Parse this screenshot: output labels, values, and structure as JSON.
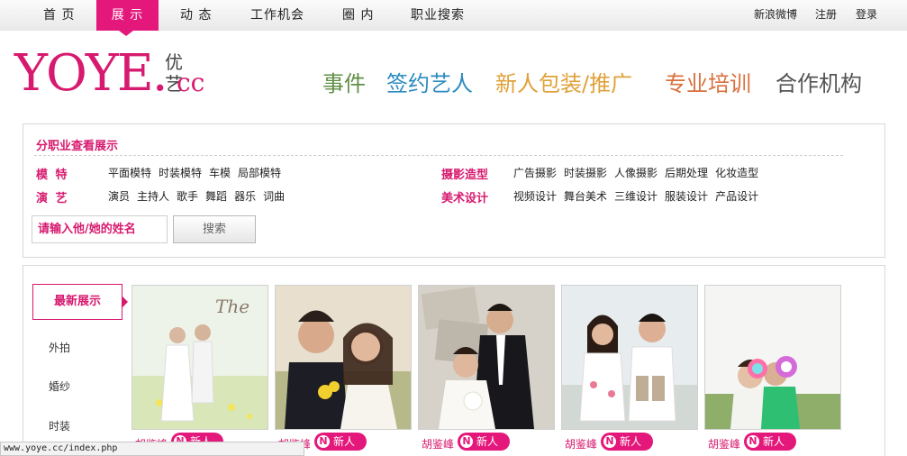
{
  "nav": {
    "items": [
      {
        "label": "首 页"
      },
      {
        "label": "展 示"
      },
      {
        "label": "动 态"
      },
      {
        "label": "工作机会"
      },
      {
        "label": "圈 内"
      },
      {
        "label": "职业搜索"
      }
    ],
    "active_index": 1,
    "right_links": [
      {
        "label": "新浪微博"
      },
      {
        "label": "注册"
      },
      {
        "label": "登录"
      }
    ],
    "active_color": "#e4187b"
  },
  "logo": {
    "main": "YOYE.",
    "cn": "优艺",
    "cc": "cc",
    "color": "#d71a6f"
  },
  "categories": [
    {
      "label": "事件",
      "color": "#5f8f45"
    },
    {
      "label": "签约艺人",
      "color": "#2b8bbf"
    },
    {
      "label": "新人包装/推广",
      "color": "#e0a13a"
    },
    {
      "label": "专业培训",
      "color": "#d96f3c"
    },
    {
      "label": "合作机构",
      "color": "#555555"
    }
  ],
  "filter": {
    "title": "分职业查看展示",
    "groups": [
      {
        "label": "模 特",
        "items": [
          "平面模特",
          "时装模特",
          "车模",
          "局部模特"
        ]
      },
      {
        "label": "演 艺",
        "items": [
          "演员",
          "主持人",
          "歌手",
          "舞蹈",
          "器乐",
          "词曲"
        ]
      },
      {
        "label": "摄影造型",
        "items": [
          "广告摄影",
          "时装摄影",
          "人像摄影",
          "后期处理",
          "化妆造型"
        ]
      },
      {
        "label": "美术设计",
        "items": [
          "视频设计",
          "舞台美术",
          "三维设计",
          "服装设计",
          "产品设计"
        ]
      }
    ],
    "name_placeholder": "请输入他/她的姓名",
    "search_label": "搜索"
  },
  "gallery": {
    "side_active": "最新展示",
    "side_items": [
      "外拍",
      "婚纱",
      "时装"
    ],
    "cards": [
      {
        "name": "胡鉴峰",
        "badge": "新人"
      },
      {
        "name": "胡鉴峰",
        "badge": "新人"
      },
      {
        "name": "胡鉴峰",
        "badge": "新人"
      },
      {
        "name": "胡鉴峰",
        "badge": "新人"
      },
      {
        "name": "胡鉴峰",
        "badge": "新人"
      }
    ],
    "badge_letter": "N"
  },
  "status_bar": {
    "url": "www.yoye.cc/index.php"
  }
}
